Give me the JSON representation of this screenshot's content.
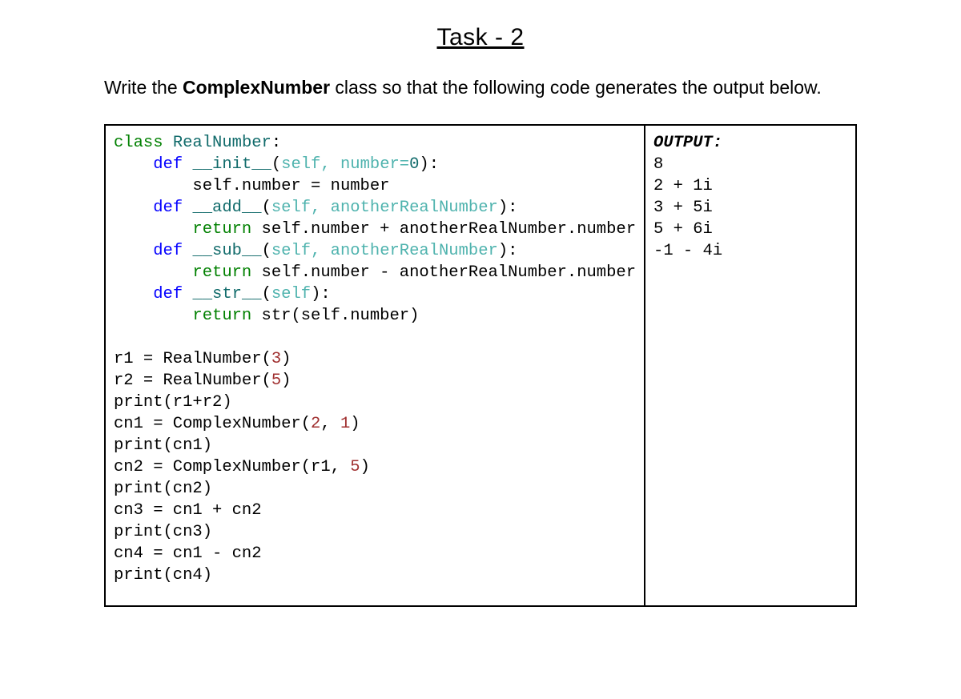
{
  "title": "Task - 2",
  "instruction": {
    "prefix": "Write the ",
    "bold": "ComplexNumber",
    "suffix": " class so that the following code generates the output below."
  },
  "code": {
    "l1a": "class",
    "l1b": " ",
    "l1c": "RealNumber",
    "l1d": ":",
    "l2a": "    ",
    "l2b": "def",
    "l2c": " ",
    "l2d": "__init__",
    "l2e": "(",
    "l2f": "self, number=",
    "l2g": "0",
    "l2h": "):",
    "l3a": "        self.number = number",
    "l4a": "    ",
    "l4b": "def",
    "l4c": " ",
    "l4d": "__add__",
    "l4e": "(",
    "l4f": "self, anotherRealNumber",
    "l4g": "):",
    "l5a": "        ",
    "l5b": "return",
    "l5c": " self.number + anotherRealNumber.number",
    "l6a": "    ",
    "l6b": "def",
    "l6c": " ",
    "l6d": "__sub__",
    "l6e": "(",
    "l6f": "self, anotherRealNumber",
    "l6g": "):",
    "l7a": "        ",
    "l7b": "return",
    "l7c": " self.number - anotherRealNumber.number",
    "l8a": "    ",
    "l8b": "def",
    "l8c": " ",
    "l8d": "__str__",
    "l8e": "(",
    "l8f": "self",
    "l8g": "):",
    "l9a": "        ",
    "l9b": "return",
    "l9c": " str(self.number)",
    "blank": "",
    "l10a": "r1 = RealNumber(",
    "l10b": "3",
    "l10c": ")",
    "l11a": "r2 = RealNumber(",
    "l11b": "5",
    "l11c": ")",
    "l12": "print(r1+r2)",
    "l13a": "cn1 = ComplexNumber(",
    "l13b": "2",
    "l13c": ", ",
    "l13d": "1",
    "l13e": ")",
    "l14": "print(cn1)",
    "l15a": "cn2 = ComplexNumber(r1, ",
    "l15b": "5",
    "l15c": ")",
    "l16": "print(cn2)",
    "l17": "cn3 = cn1 + cn2",
    "l18": "print(cn3)",
    "l19": "cn4 = cn1 - cn2",
    "l20": "print(cn4)"
  },
  "output": {
    "title": "OUTPUT:",
    "lines": [
      "8",
      "2 + 1i",
      "3 + 5i",
      "5 + 6i",
      "-1 - 4i"
    ]
  }
}
